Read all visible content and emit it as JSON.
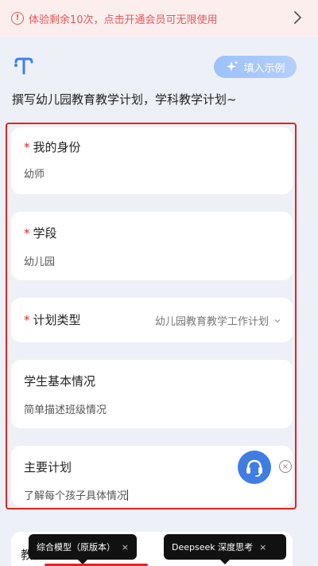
{
  "banner": {
    "text": "体验剩余10次，点击开通会员可无限使用",
    "icon": "exclamation-circle-icon",
    "accent": "#e35a5a"
  },
  "header": {
    "logo_icon": "brand-t-logo-icon",
    "fill_example_label": "填入示例",
    "subtitle": "撰写幼儿园教育教学计划，学科教学计划~"
  },
  "form": {
    "identity": {
      "label": "我的身份",
      "required": true,
      "value": "幼师"
    },
    "stage": {
      "label": "学段",
      "required": true,
      "value": "幼儿园"
    },
    "plan_type": {
      "label": "计划类型",
      "required": true,
      "value": "幼儿园教育教学工作计划"
    },
    "student_basic": {
      "label": "学生基本情况",
      "placeholder": "简单描述班级情况"
    },
    "main_plan": {
      "label": "主要计划",
      "value": "了解每个孩子具体情况"
    }
  },
  "bottom": {
    "partial_label": "教",
    "model_tags": [
      {
        "label": "综合模型（原版本）",
        "close": "×"
      },
      {
        "label": "Deepseek 深度思考",
        "close": "×"
      }
    ]
  },
  "colors": {
    "background": "#eef0f7",
    "required_marker": "#e02424",
    "voice_button": "#3f7de3",
    "fill_button": "#9cc1fb"
  }
}
